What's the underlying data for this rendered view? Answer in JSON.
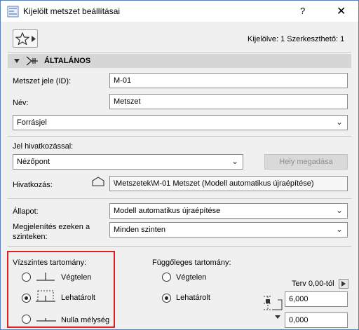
{
  "window": {
    "title": "Kijelölt metszet beállításai",
    "help_glyph": "?",
    "close_glyph": "✕"
  },
  "selection_info": "Kijelölve: 1 Szerkeszthető: 1",
  "section": {
    "title": "ÁLTALÁNOS"
  },
  "fields": {
    "id_label": "Metszet jele (ID):",
    "id_value": "M-01",
    "name_label": "Név:",
    "name_value": "Metszet",
    "source_marker": "Forrásjel",
    "ref_label": "Jel hivatkozással:",
    "ref_value": "Nézőpont",
    "locate_button": "Hely megadása",
    "ref_to_label": "Hivatkozás:",
    "ref_to_value": "\\Metszetek\\M-01 Metszet (Modell automatikus újraépítése)",
    "status_label": "Állapot:",
    "status_value": "Modell automatikus újraépítése",
    "show_on_label_line1": "Megjelenítés ezeken a",
    "show_on_label_line2": "szinteken:",
    "show_on_value": "Minden szinten"
  },
  "horizontal_range": {
    "title": "Vízszintes tartomány:",
    "options": [
      {
        "label": "Végtelen",
        "selected": false
      },
      {
        "label": "Lehatárolt",
        "selected": true
      },
      {
        "label": "Nulla mélység",
        "selected": false
      }
    ]
  },
  "vertical_range": {
    "title": "Függőleges tartomány:",
    "options": [
      {
        "label": "Végtelen",
        "selected": false
      },
      {
        "label": "Lehatárolt",
        "selected": true
      }
    ],
    "reference": "Terv 0,00-tól",
    "top_value": "6,000",
    "bottom_value": "0,000"
  }
}
